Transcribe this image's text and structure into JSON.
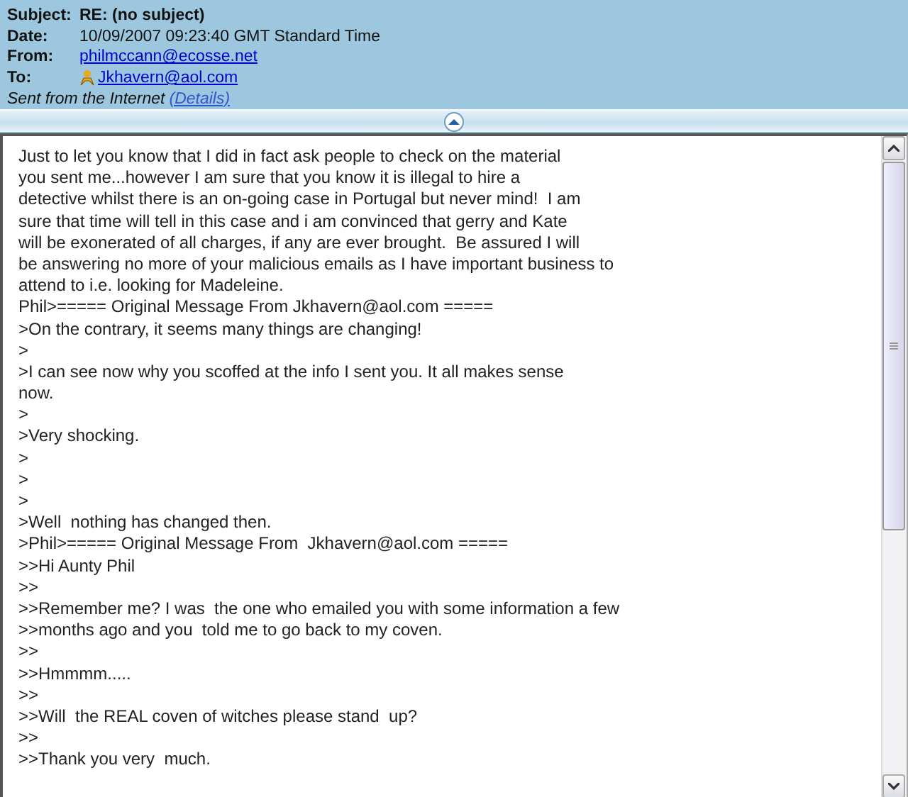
{
  "header": {
    "fields": [
      {
        "label": "Subject:",
        "value": "RE: (no subject)",
        "kind": "bold"
      },
      {
        "label": "Date:",
        "value": "10/09/2007 09:23:40 GMT Standard Time",
        "kind": "plain"
      },
      {
        "label": "From:",
        "value": "philmccann@ecosse.net",
        "kind": "link"
      },
      {
        "label": "To:",
        "value": "Jkhavern@aol.com",
        "kind": "person-link"
      }
    ],
    "note": "Sent from the Internet",
    "details_link": "(Details)"
  },
  "body": {
    "lines": [
      "Just to let you know that I did in fact ask people to check on the material",
      "you sent me...however I am sure that you know it is illegal to hire a",
      "detective whilst there is an on-going case in Portugal but never mind!  I am",
      "sure that time will tell in this case and i am convinced that gerry and Kate",
      "will be exonerated of all charges, if any are ever brought.  Be assured I will",
      "be answering no more of your malicious emails as I have important business to",
      "attend to i.e. looking for Madeleine.",
      "Phil>===== Original Message From Jkhavern@aol.com =====",
      ">On the contrary, it seems many things are changing!",
      ">",
      ">I can see now why you scoffed at the info I sent you. It all makes sense",
      "now.",
      ">",
      ">Very shocking.",
      ">",
      ">",
      ">",
      ">Well  nothing has changed then.",
      ">Phil>===== Original Message From  Jkhavern@aol.com =====",
      ">>Hi Aunty Phil",
      ">>",
      ">>Remember me? I was  the one who emailed you with some information a few",
      ">>months ago and you  told me to go back to my coven.",
      ">>",
      ">>Hmmmm.....",
      ">>",
      ">>Will  the REAL coven of witches please stand  up?",
      ">>",
      ">>Thank you very  much."
    ]
  }
}
